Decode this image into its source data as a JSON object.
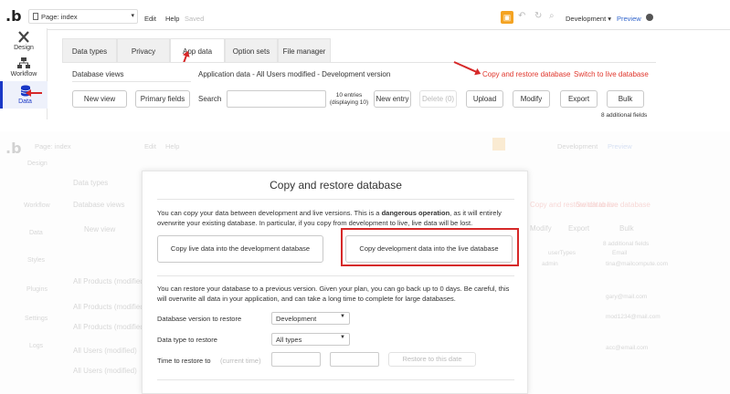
{
  "header": {
    "page_label": "Page: index",
    "menu": [
      "Edit",
      "Help"
    ],
    "saved": "Saved",
    "environment": "Development",
    "preview": "Preview"
  },
  "leftnav": {
    "items": [
      "Design",
      "Workflow",
      "Data"
    ],
    "faded_items": [
      "Design",
      "Workflow",
      "Data",
      "Styles",
      "Plugins",
      "Settings",
      "Logs"
    ]
  },
  "tabs": [
    "Data types",
    "Privacy",
    "App data",
    "Option sets",
    "File manager"
  ],
  "panel": {
    "database_views": "Database views",
    "app_data_title": "Application data - All Users modified - Development version",
    "copy_restore_link": "Copy and restore database",
    "switch_live_link": "Switch to live database",
    "new_view": "New view",
    "primary_fields": "Primary fields",
    "search_label": "Search",
    "entries_line1": "10 entries",
    "entries_line2": "(displaying 10)",
    "new_entry": "New entry",
    "delete": "Delete (0)",
    "upload": "Upload",
    "modify": "Modify",
    "export": "Export",
    "bulk": "Bulk",
    "additional_fields": "8 additional fields"
  },
  "faded": {
    "tabs": [
      "Data types",
      "Privacy"
    ],
    "database_views": "Database views",
    "new_view": "New view",
    "rows": [
      "All Products (modified)",
      "All Products (modified)",
      "All Products (modified)",
      "All Users (modified)",
      "All Users (modified)"
    ],
    "right_links": [
      "Copy and restore database",
      "Switch to live database"
    ],
    "emails": [
      "tina@mailcompute.com",
      "gary@mail.com",
      "mod1234@mail.com",
      "acc@email.com"
    ],
    "col_user_types": "userTypes",
    "col_email": "Email",
    "modify": "Modify",
    "export": "Export",
    "bulk": "Bulk",
    "additional_fields": "8 additional fields",
    "admin": "admin",
    "user": "user",
    "env": "Development",
    "preview": "Preview"
  },
  "modal": {
    "title": "Copy and restore database",
    "intro_before": "You can copy your data between development and live versions. This is a ",
    "intro_bold": "dangerous operation",
    "intro_after": ", as it will entirely overwrite your existing database. In particular, if you copy from development to live, live data will be lost.",
    "copy_live_to_dev": "Copy live data into the development database",
    "copy_dev_to_live": "Copy development data into the live database",
    "restore_text": "You can restore your database to a previous version. Given your plan, you can go back up to 0 days. Be careful, this will overwrite all data in your application, and can take a long time to complete for large databases.",
    "version_label": "Database version to restore",
    "version_value": "Development",
    "datatype_label": "Data type to restore",
    "datatype_value": "All types",
    "time_label": "Time to restore to",
    "time_placeholder": "(current time)",
    "restore_button": "Restore to this date"
  },
  "colors": {
    "accent_red": "#d62828",
    "link_red": "#e0362c",
    "active_blue": "#1a38c6",
    "gift_orange": "#f4a322"
  }
}
